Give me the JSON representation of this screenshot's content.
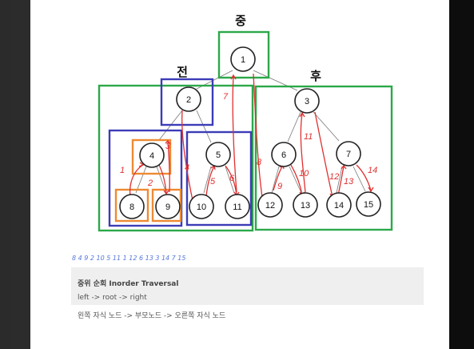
{
  "labels": {
    "middle": "중",
    "left": "전",
    "right": "후"
  },
  "nodes": [
    "1",
    "2",
    "3",
    "4",
    "5",
    "6",
    "7",
    "8",
    "9",
    "10",
    "11",
    "12",
    "13",
    "14",
    "15"
  ],
  "traversal_order_marks": [
    "1",
    "2",
    "3",
    "4",
    "5",
    "6",
    "7",
    "8",
    "9",
    "10",
    "11",
    "12",
    "13",
    "14"
  ],
  "sequence": "8 4 9 2 10 5 11 1 12 6 13 3 14 7 15",
  "note": {
    "title": "중위 순회 Inorder Traversal",
    "line1": "left -> root -> right",
    "line2": "왼쪽 자식 노드  -> 부모노드 -> 오른쪽 자식 노드"
  },
  "colors": {
    "green": "#2ca84a",
    "blue": "#3c3cb8",
    "orange": "#ee8a33",
    "red": "#e03030"
  }
}
